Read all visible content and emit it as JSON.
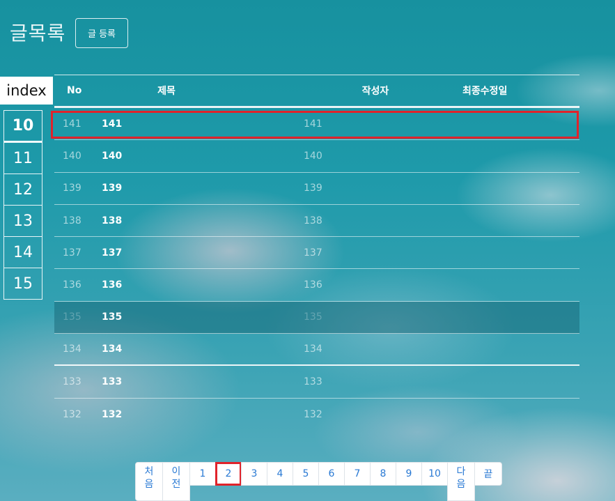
{
  "page": {
    "title": "글목록",
    "register_button": "글 등록"
  },
  "index": {
    "label": "index",
    "items": [
      "10",
      "11",
      "12",
      "13",
      "14",
      "15"
    ]
  },
  "table": {
    "headers": {
      "no": "No",
      "title": "제목",
      "author": "작성자",
      "date": "최종수정일"
    },
    "rows": [
      {
        "no": "141",
        "title": "141",
        "author": "141",
        "date": ""
      },
      {
        "no": "140",
        "title": "140",
        "author": "140",
        "date": ""
      },
      {
        "no": "139",
        "title": "139",
        "author": "139",
        "date": ""
      },
      {
        "no": "138",
        "title": "138",
        "author": "138",
        "date": ""
      },
      {
        "no": "137",
        "title": "137",
        "author": "137",
        "date": ""
      },
      {
        "no": "136",
        "title": "136",
        "author": "136",
        "date": ""
      },
      {
        "no": "135",
        "title": "135",
        "author": "135",
        "date": ""
      },
      {
        "no": "134",
        "title": "134",
        "author": "134",
        "date": ""
      },
      {
        "no": "133",
        "title": "133",
        "author": "133",
        "date": ""
      },
      {
        "no": "132",
        "title": "132",
        "author": "132",
        "date": ""
      }
    ]
  },
  "pagination": {
    "first": [
      "처",
      "음"
    ],
    "prev": [
      "이",
      "전"
    ],
    "pages": [
      "1",
      "2",
      "3",
      "4",
      "5",
      "6",
      "7",
      "8",
      "9",
      "10"
    ],
    "current": "2",
    "next": [
      "다",
      "음"
    ],
    "last": "끝"
  },
  "colors": {
    "highlight": "#e0232b",
    "link": "#2a7ad4",
    "background": "#1e9aaa"
  }
}
